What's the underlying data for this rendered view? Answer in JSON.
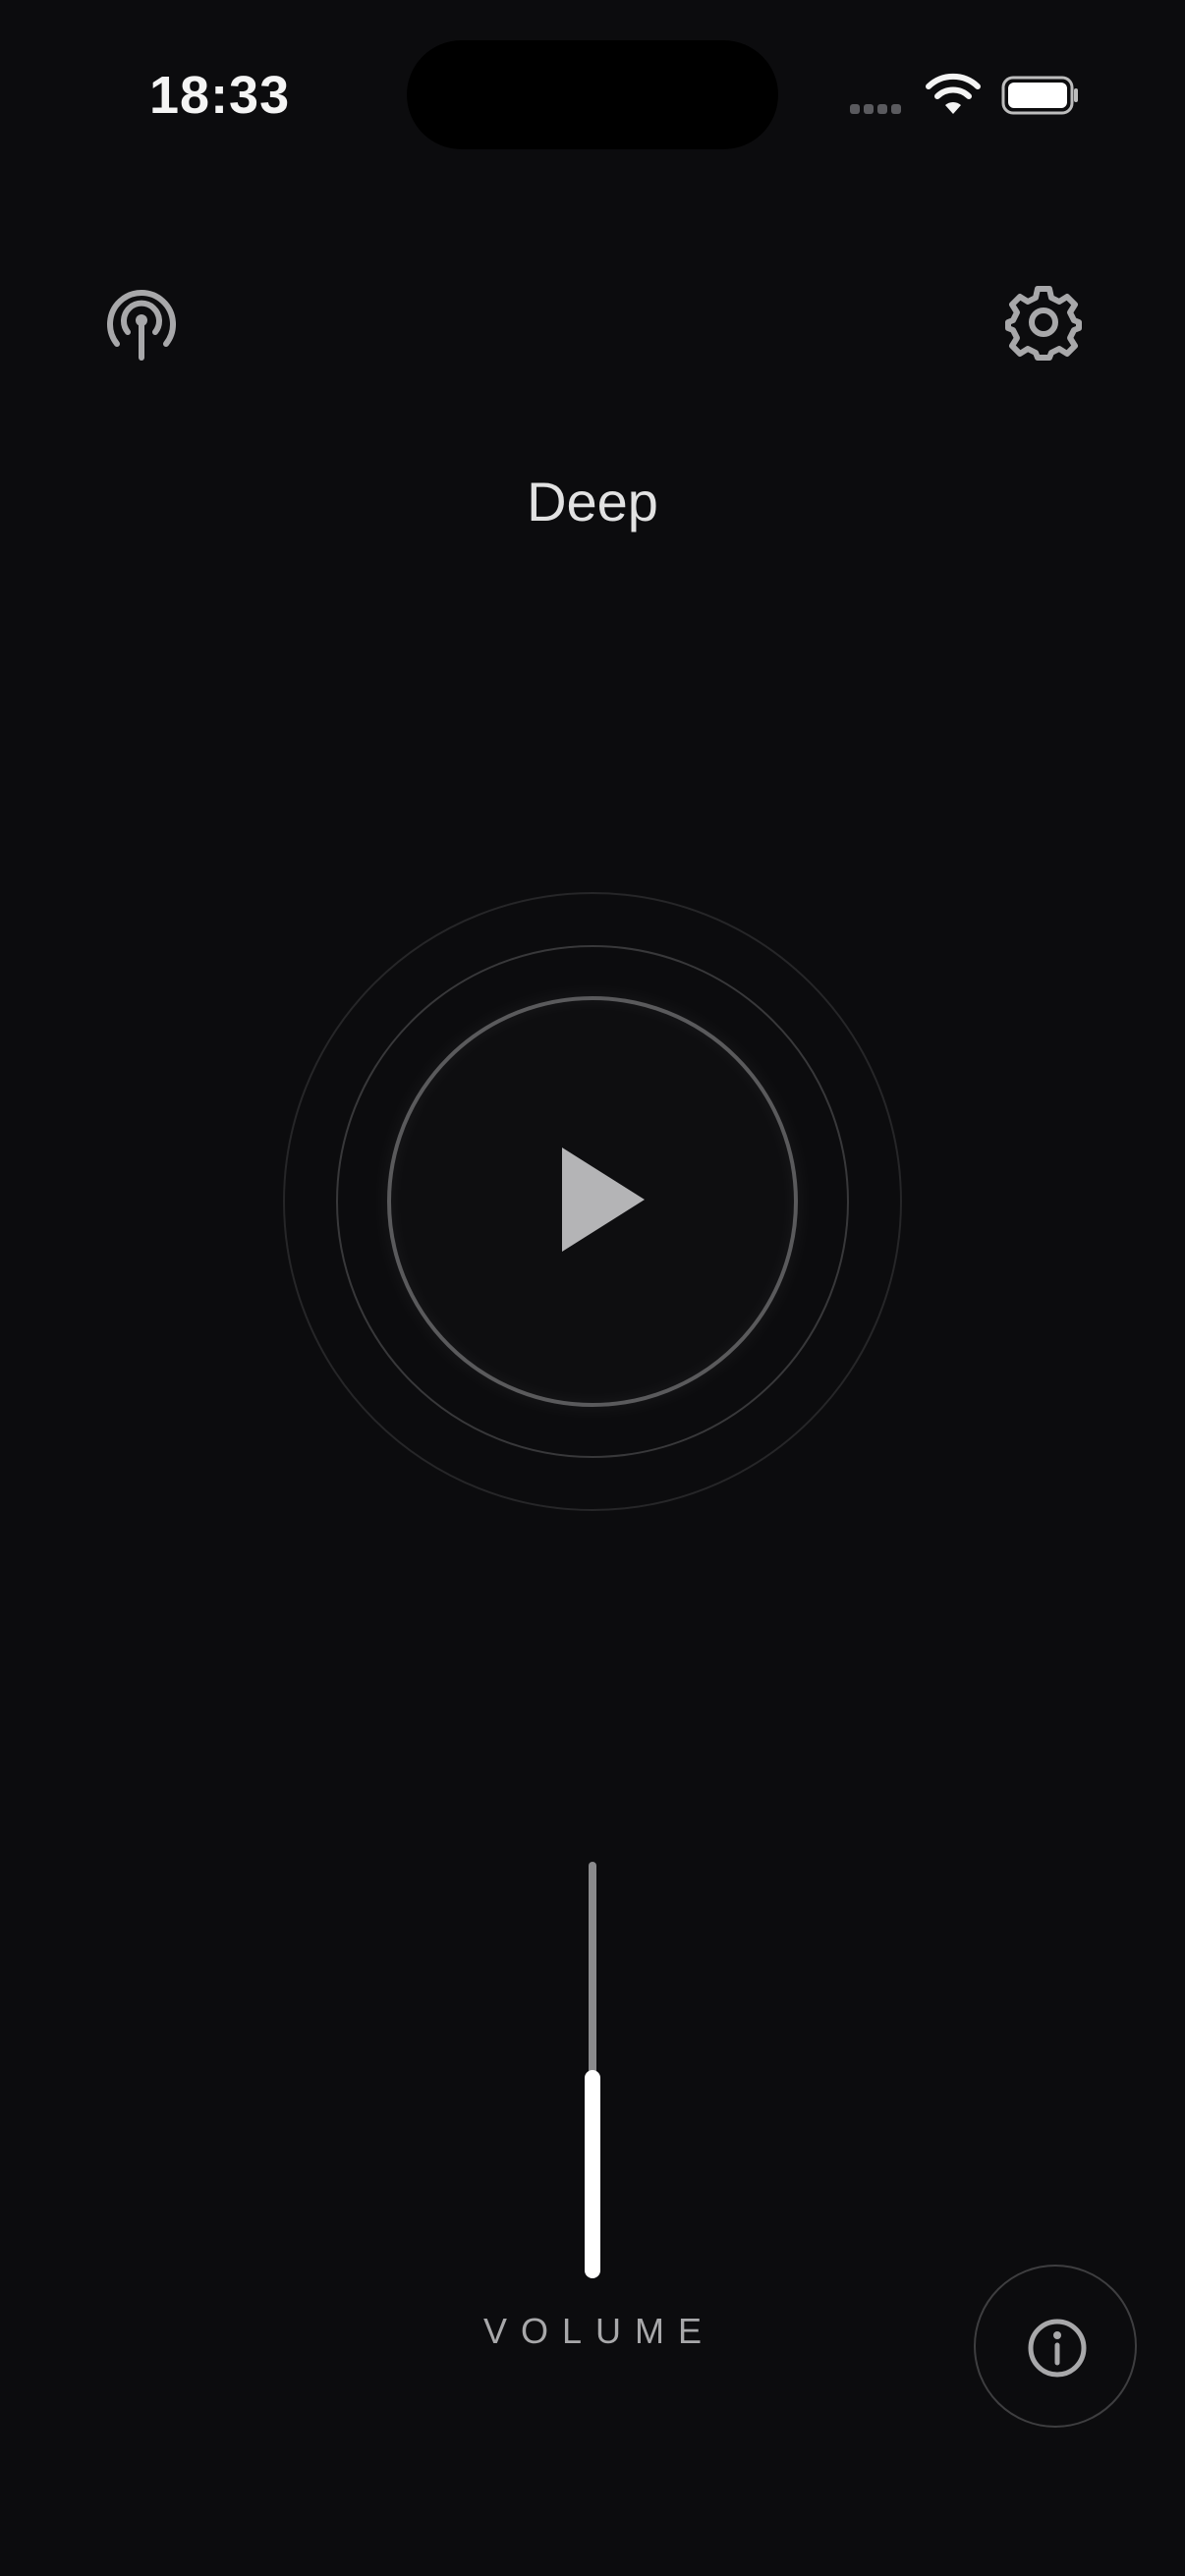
{
  "status_bar": {
    "time": "18:33",
    "icons": [
      "cellular-signal-icon",
      "wifi-icon",
      "battery-icon"
    ]
  },
  "header": {
    "left_icon": "podcast-icon",
    "right_icon": "gear-icon",
    "title": "Deep"
  },
  "player": {
    "state_icon": "play-icon"
  },
  "volume": {
    "label": "VOLUME",
    "level": 0.5
  },
  "info": {
    "icon": "info-icon"
  },
  "colors": {
    "background": "#0c0c0e",
    "accent": "#ffffff",
    "icon": "#a8a8aa"
  }
}
